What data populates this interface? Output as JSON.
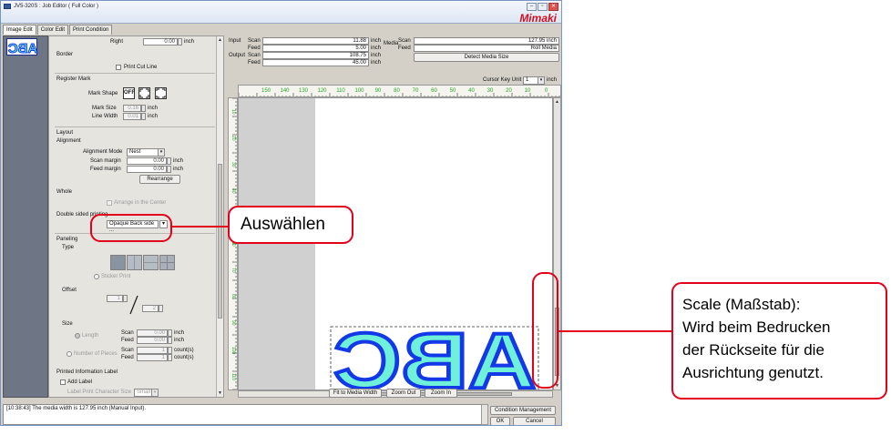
{
  "window": {
    "title": "JV5-320S : Job Editor ( Full Color )",
    "logo": "Mimaki",
    "buttons": [
      "–",
      "▫",
      "✕"
    ]
  },
  "tabs": [
    "Image Edit",
    "Color Edit",
    "Print Condition"
  ],
  "left_panel": {
    "right_label": "Right",
    "right_value": "0.00",
    "unit_inch": "inch",
    "border_label": "Border",
    "print_cut_line": "Print Cut Line",
    "register_mark": "Register Mark",
    "mark_shape_label": "Mark Shape",
    "mark_shape_off": "OFF",
    "mark_size_label": "Mark Size",
    "mark_size_value": "0.16",
    "line_width_label": "Line Width",
    "line_width_value": "0.01",
    "layout_label": "Layout",
    "alignment_label": "Alignment",
    "alignment_mode_label": "Alignment Mode",
    "alignment_mode_value": "Nest",
    "scan_margin_label": "Scan margin",
    "scan_margin_value": "0.00",
    "feed_margin_label": "Feed margin",
    "feed_margin_value": "0.00",
    "rearrange_button": "Rearrange",
    "whole_label": "Whole",
    "arrange_center": "Arrange in the Center",
    "double_sided_label": "Double sided printing",
    "double_sided_value": "Opaque Back side ...",
    "paneling_label": "Paneling",
    "type_label": "Type",
    "sticker_print": "Sticker Print",
    "offset_label": "Offset",
    "offset_a": "1",
    "offset_b": "2",
    "size_label": "Size",
    "length_label": "Length",
    "number_of_pieces_label": "Number of Pieces",
    "scan_label": "Scan",
    "feed_label": "Feed",
    "len_scan_value": "0.00",
    "len_feed_value": "0.00",
    "pcs_scan_value": "1",
    "pcs_feed_value": "1",
    "count_unit": "count(s)",
    "printed_info_label": "Printed Information Label",
    "add_label": "Add Label",
    "label_char_size_label": "Label Print Character Size",
    "label_char_size_value": "Small"
  },
  "right_panel": {
    "input_label": "Input",
    "output_label": "Output",
    "scan_label": "Scan",
    "feed_label": "Feed",
    "input_scan": "11.88",
    "input_feed": "5.00",
    "output_scan": "108.75",
    "output_feed": "45.00",
    "unit_inch": "inch",
    "media_label": "Media",
    "media_scan_value": "127.95 inch",
    "media_feed_value": "Roll Media",
    "detect_button": "Detect Media Size",
    "cursor_key_unit_label": "Cursor Key Unit",
    "cursor_key_unit_value": "1",
    "ruler_numbers": [
      "150",
      "140",
      "130",
      "120",
      "110",
      "100",
      "90",
      "80",
      "70",
      "60",
      "50",
      "40",
      "30",
      "20",
      "10",
      "0"
    ],
    "left_ruler_numbers": [
      "10",
      "20",
      "30",
      "40",
      "50",
      "60",
      "70",
      "80",
      "90",
      "100",
      "110"
    ],
    "art_text": "ABC",
    "fit_button": "Fit to Media Width",
    "zoom_out_button": "Zoom Out",
    "zoom_in_button": "Zoom In"
  },
  "log": {
    "message": "[10:38:43] The media width is 127.95 inch (Manual Input)."
  },
  "footer_buttons": {
    "condition": "Condition Management",
    "ok": "OK",
    "cancel": "Cancel"
  },
  "callouts": {
    "select": "Auswählen",
    "scale_lines": [
      "Scale (Maßstab):",
      "Wird beim Bedrucken",
      "der Rückseite für die",
      "Ausrichtung genutzt."
    ]
  },
  "colors": {
    "annotation_red": "#e3001b",
    "art_fill": "#6ff0d8",
    "art_stroke": "#1238e8",
    "ruler_text": "#22aa22"
  }
}
